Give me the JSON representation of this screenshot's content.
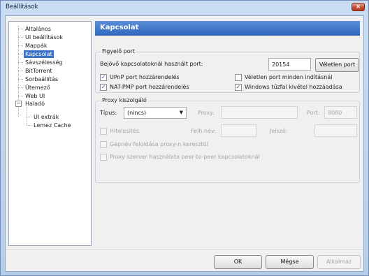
{
  "window": {
    "title": "Beállítások",
    "close_label": "×"
  },
  "tree": {
    "items": [
      "Általános",
      "UI beállítások",
      "Mappák",
      "Kapcsolat",
      "Sávszélesség",
      "BitTorrent",
      "Sorbaállítás",
      "Ütemező",
      "Web UI",
      "Haladó",
      "UI extrák",
      "Lemez Cache"
    ],
    "expander": "−"
  },
  "header": {
    "title": "Kapcsolat"
  },
  "listen": {
    "legend": "Figyelő port",
    "port_label": "Bejövő kapcsolatoknál használt port:",
    "port_value": "20154",
    "random_button": "Véletlen port",
    "upnp": "UPnP port hozzárendelés",
    "natpmp": "NAT-PMP port hozzárendelés",
    "random_each_start": "Véletlen port minden indításnál",
    "firewall": "Windows tűzfal kivétel hozzáadása",
    "check_mark": "✓"
  },
  "proxy": {
    "legend": "Proxy kiszolgáló",
    "type_label": "Típus:",
    "type_value": "(nincs)",
    "dropdown_arrow": "▼",
    "proxy_label": "Proxy:",
    "port_label": "Port:",
    "port_value": "8080",
    "auth": "Hitelesítés",
    "username_label": "Felh.név:",
    "password_label": "Jelszó:",
    "resolve_hostnames": "Gépnév feloldása proxy-n keresztül",
    "use_for_p2p": "Proxy szerver használata peer-to-peer kapcsolatoknál"
  },
  "buttons": {
    "ok": "OK",
    "cancel": "Mégse",
    "apply": "Alkalmaz"
  }
}
